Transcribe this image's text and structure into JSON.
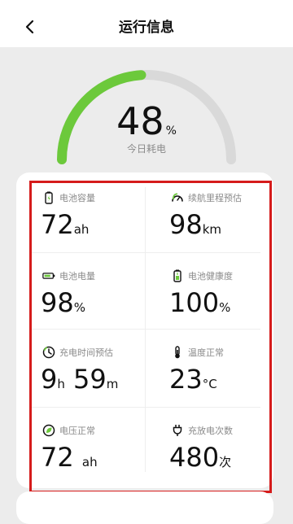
{
  "header": {
    "title": "运行信息"
  },
  "gauge": {
    "value": "48",
    "unit": "%",
    "label": "今日耗电",
    "fraction": 0.48
  },
  "colors": {
    "accent": "#6cc93b",
    "track": "#d9d9d9",
    "highlight": "#d51b1b"
  },
  "metrics": [
    {
      "label": "电池容量",
      "icon": "battery-vertical-icon",
      "value": "72",
      "unit": "ah"
    },
    {
      "label": "续航里程预估",
      "icon": "speedometer-icon",
      "value": "98",
      "unit": "km"
    },
    {
      "label": "电池电量",
      "icon": "battery-horizontal-icon",
      "value": "98",
      "unit": "%"
    },
    {
      "label": "电池健康度",
      "icon": "battery-health-icon",
      "value": "100",
      "unit": "%"
    },
    {
      "label": "充电时间预估",
      "icon": "clock-icon",
      "hours": "9",
      "hours_unit": "h",
      "minutes": "59",
      "minutes_unit": "m"
    },
    {
      "label": "温度正常",
      "icon": "thermometer-icon",
      "value": "23",
      "unit": "°C"
    },
    {
      "label": "电压正常",
      "icon": "leaf-icon",
      "value": "72",
      "unit": "ah"
    },
    {
      "label": "充放电次数",
      "icon": "plug-icon",
      "value": "480",
      "unit": "次"
    }
  ]
}
